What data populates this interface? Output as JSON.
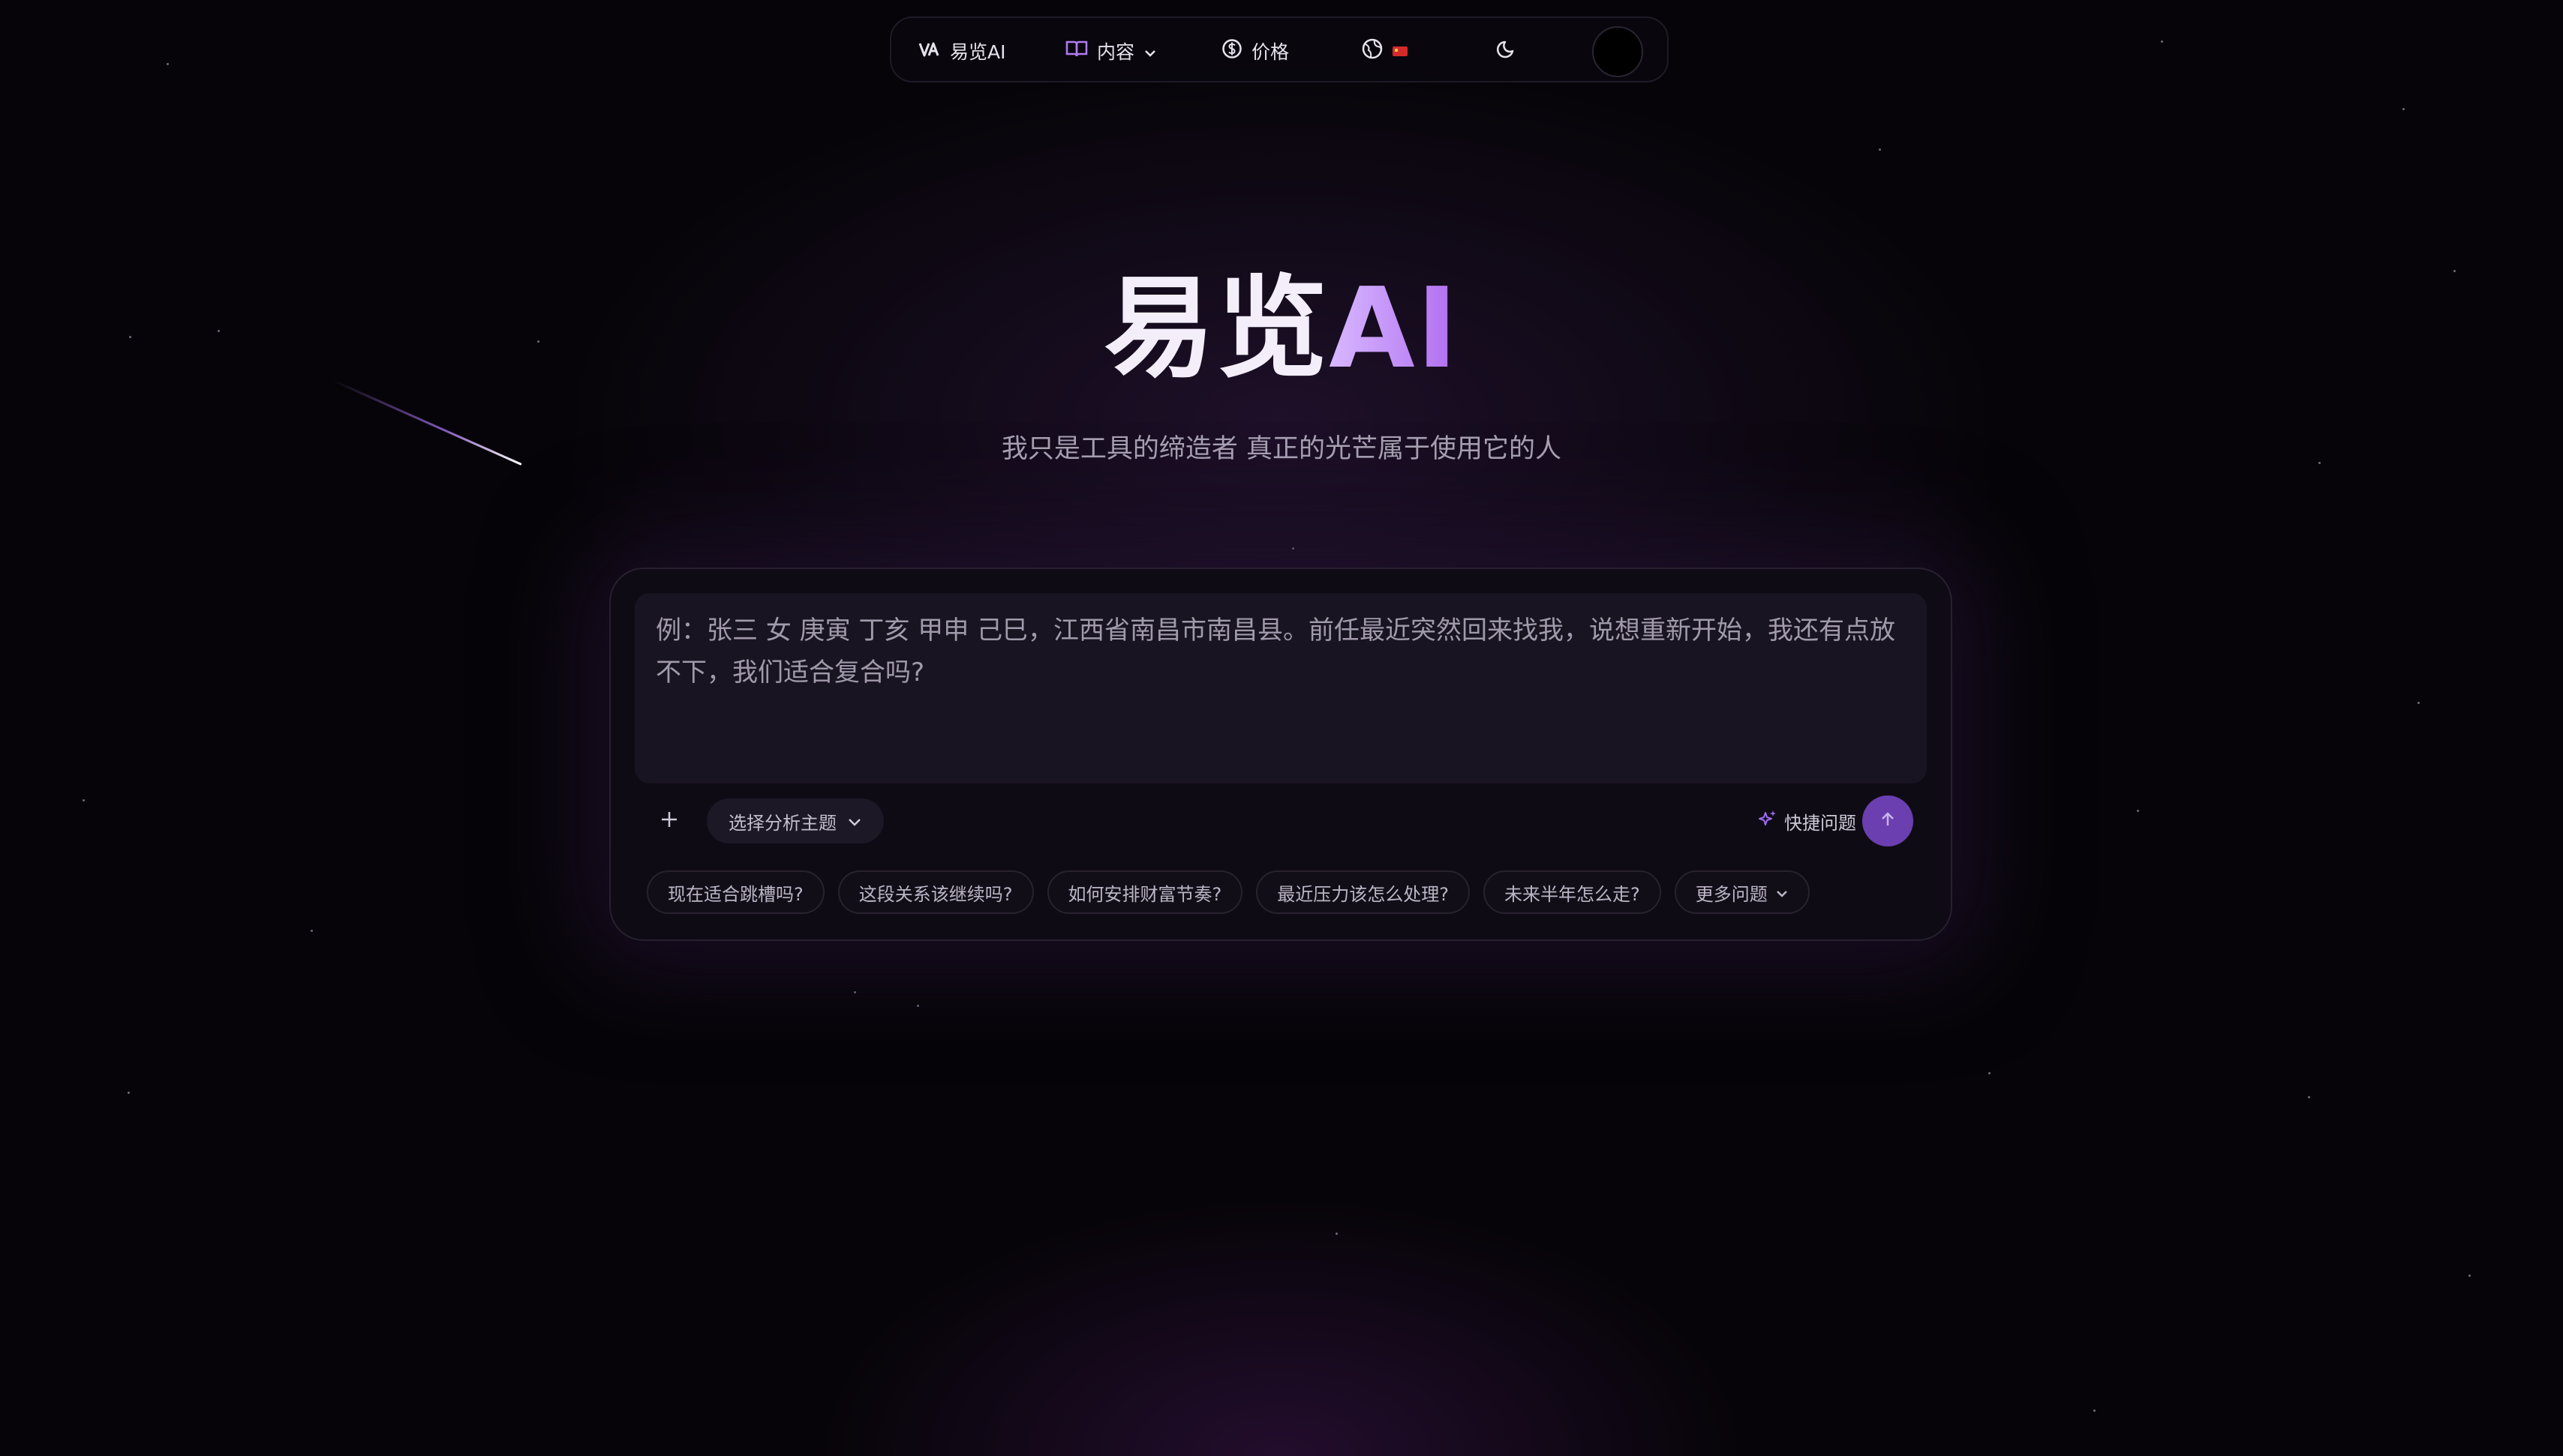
{
  "nav": {
    "brand_label": "易览AI",
    "content_label": "内容",
    "price_label": "价格"
  },
  "hero": {
    "title_main": "易览",
    "title_accent": "AI",
    "subtitle": "我只是工具的缔造者 真正的光芒属于使用它的人"
  },
  "composer": {
    "placeholder": "例：张三 女 庚寅 丁亥 甲申 己巳，江西省南昌市南昌县。前任最近突然回来找我，说想重新开始，我还有点放不下，我们适合复合吗?",
    "value": "",
    "theme_select_label": "选择分析主题",
    "quick_label": "快捷问题"
  },
  "suggestions": [
    "现在适合跳槽吗?",
    "这段关系该继续吗?",
    "如何安排财富节奏?",
    "最近压力该怎么处理?",
    "未来半年怎么走?"
  ],
  "more_label": "更多问题",
  "colors": {
    "background": "#060408",
    "accent": "#b06cf0",
    "send_button": "#6b3fb0"
  }
}
